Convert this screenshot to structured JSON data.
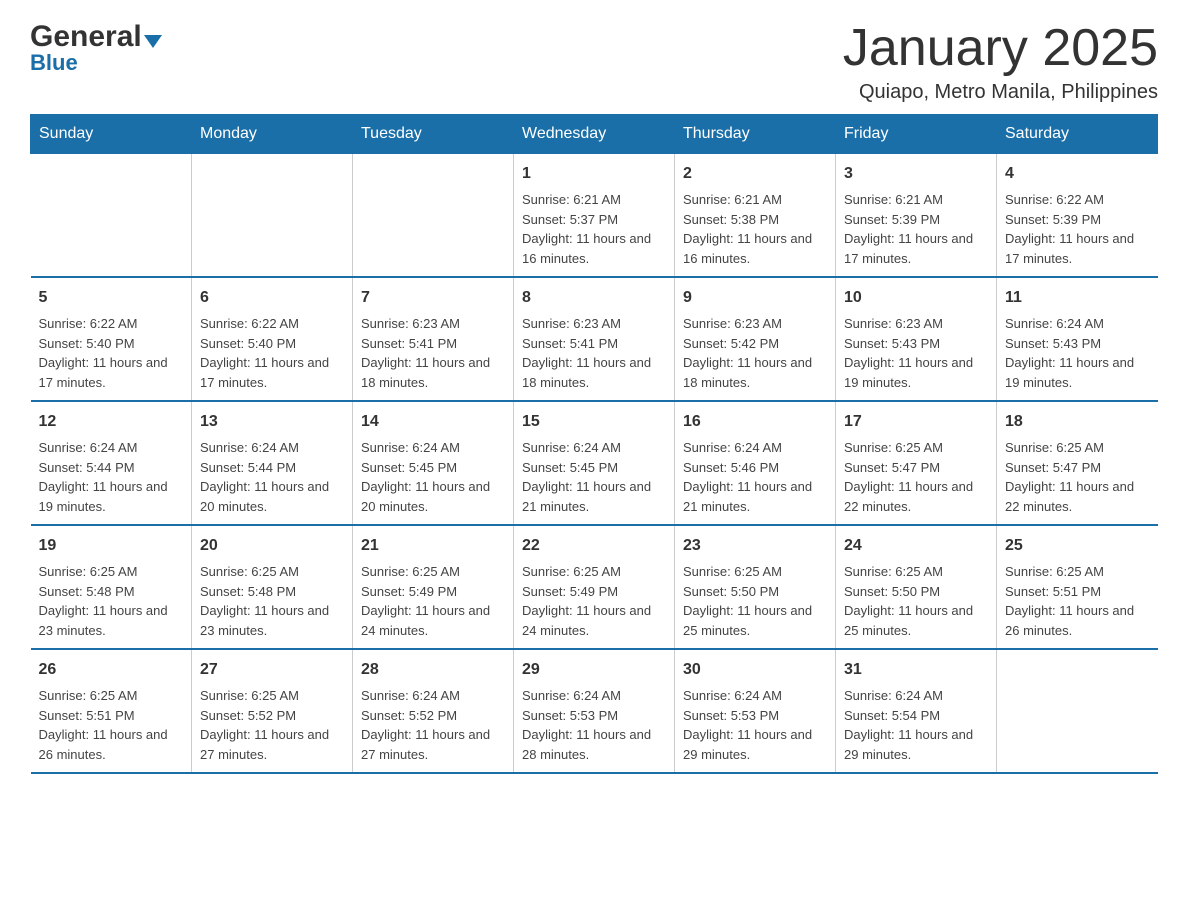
{
  "header": {
    "month_title": "January 2025",
    "location": "Quiapo, Metro Manila, Philippines"
  },
  "logo": {
    "line1_general": "General",
    "line2_blue": "Blue"
  },
  "days_of_week": [
    "Sunday",
    "Monday",
    "Tuesday",
    "Wednesday",
    "Thursday",
    "Friday",
    "Saturday"
  ],
  "weeks": [
    [
      {
        "day": "",
        "sunrise": "",
        "sunset": "",
        "daylight": ""
      },
      {
        "day": "",
        "sunrise": "",
        "sunset": "",
        "daylight": ""
      },
      {
        "day": "",
        "sunrise": "",
        "sunset": "",
        "daylight": ""
      },
      {
        "day": "1",
        "sunrise": "Sunrise: 6:21 AM",
        "sunset": "Sunset: 5:37 PM",
        "daylight": "Daylight: 11 hours and 16 minutes."
      },
      {
        "day": "2",
        "sunrise": "Sunrise: 6:21 AM",
        "sunset": "Sunset: 5:38 PM",
        "daylight": "Daylight: 11 hours and 16 minutes."
      },
      {
        "day": "3",
        "sunrise": "Sunrise: 6:21 AM",
        "sunset": "Sunset: 5:39 PM",
        "daylight": "Daylight: 11 hours and 17 minutes."
      },
      {
        "day": "4",
        "sunrise": "Sunrise: 6:22 AM",
        "sunset": "Sunset: 5:39 PM",
        "daylight": "Daylight: 11 hours and 17 minutes."
      }
    ],
    [
      {
        "day": "5",
        "sunrise": "Sunrise: 6:22 AM",
        "sunset": "Sunset: 5:40 PM",
        "daylight": "Daylight: 11 hours and 17 minutes."
      },
      {
        "day": "6",
        "sunrise": "Sunrise: 6:22 AM",
        "sunset": "Sunset: 5:40 PM",
        "daylight": "Daylight: 11 hours and 17 minutes."
      },
      {
        "day": "7",
        "sunrise": "Sunrise: 6:23 AM",
        "sunset": "Sunset: 5:41 PM",
        "daylight": "Daylight: 11 hours and 18 minutes."
      },
      {
        "day": "8",
        "sunrise": "Sunrise: 6:23 AM",
        "sunset": "Sunset: 5:41 PM",
        "daylight": "Daylight: 11 hours and 18 minutes."
      },
      {
        "day": "9",
        "sunrise": "Sunrise: 6:23 AM",
        "sunset": "Sunset: 5:42 PM",
        "daylight": "Daylight: 11 hours and 18 minutes."
      },
      {
        "day": "10",
        "sunrise": "Sunrise: 6:23 AM",
        "sunset": "Sunset: 5:43 PM",
        "daylight": "Daylight: 11 hours and 19 minutes."
      },
      {
        "day": "11",
        "sunrise": "Sunrise: 6:24 AM",
        "sunset": "Sunset: 5:43 PM",
        "daylight": "Daylight: 11 hours and 19 minutes."
      }
    ],
    [
      {
        "day": "12",
        "sunrise": "Sunrise: 6:24 AM",
        "sunset": "Sunset: 5:44 PM",
        "daylight": "Daylight: 11 hours and 19 minutes."
      },
      {
        "day": "13",
        "sunrise": "Sunrise: 6:24 AM",
        "sunset": "Sunset: 5:44 PM",
        "daylight": "Daylight: 11 hours and 20 minutes."
      },
      {
        "day": "14",
        "sunrise": "Sunrise: 6:24 AM",
        "sunset": "Sunset: 5:45 PM",
        "daylight": "Daylight: 11 hours and 20 minutes."
      },
      {
        "day": "15",
        "sunrise": "Sunrise: 6:24 AM",
        "sunset": "Sunset: 5:45 PM",
        "daylight": "Daylight: 11 hours and 21 minutes."
      },
      {
        "day": "16",
        "sunrise": "Sunrise: 6:24 AM",
        "sunset": "Sunset: 5:46 PM",
        "daylight": "Daylight: 11 hours and 21 minutes."
      },
      {
        "day": "17",
        "sunrise": "Sunrise: 6:25 AM",
        "sunset": "Sunset: 5:47 PM",
        "daylight": "Daylight: 11 hours and 22 minutes."
      },
      {
        "day": "18",
        "sunrise": "Sunrise: 6:25 AM",
        "sunset": "Sunset: 5:47 PM",
        "daylight": "Daylight: 11 hours and 22 minutes."
      }
    ],
    [
      {
        "day": "19",
        "sunrise": "Sunrise: 6:25 AM",
        "sunset": "Sunset: 5:48 PM",
        "daylight": "Daylight: 11 hours and 23 minutes."
      },
      {
        "day": "20",
        "sunrise": "Sunrise: 6:25 AM",
        "sunset": "Sunset: 5:48 PM",
        "daylight": "Daylight: 11 hours and 23 minutes."
      },
      {
        "day": "21",
        "sunrise": "Sunrise: 6:25 AM",
        "sunset": "Sunset: 5:49 PM",
        "daylight": "Daylight: 11 hours and 24 minutes."
      },
      {
        "day": "22",
        "sunrise": "Sunrise: 6:25 AM",
        "sunset": "Sunset: 5:49 PM",
        "daylight": "Daylight: 11 hours and 24 minutes."
      },
      {
        "day": "23",
        "sunrise": "Sunrise: 6:25 AM",
        "sunset": "Sunset: 5:50 PM",
        "daylight": "Daylight: 11 hours and 25 minutes."
      },
      {
        "day": "24",
        "sunrise": "Sunrise: 6:25 AM",
        "sunset": "Sunset: 5:50 PM",
        "daylight": "Daylight: 11 hours and 25 minutes."
      },
      {
        "day": "25",
        "sunrise": "Sunrise: 6:25 AM",
        "sunset": "Sunset: 5:51 PM",
        "daylight": "Daylight: 11 hours and 26 minutes."
      }
    ],
    [
      {
        "day": "26",
        "sunrise": "Sunrise: 6:25 AM",
        "sunset": "Sunset: 5:51 PM",
        "daylight": "Daylight: 11 hours and 26 minutes."
      },
      {
        "day": "27",
        "sunrise": "Sunrise: 6:25 AM",
        "sunset": "Sunset: 5:52 PM",
        "daylight": "Daylight: 11 hours and 27 minutes."
      },
      {
        "day": "28",
        "sunrise": "Sunrise: 6:24 AM",
        "sunset": "Sunset: 5:52 PM",
        "daylight": "Daylight: 11 hours and 27 minutes."
      },
      {
        "day": "29",
        "sunrise": "Sunrise: 6:24 AM",
        "sunset": "Sunset: 5:53 PM",
        "daylight": "Daylight: 11 hours and 28 minutes."
      },
      {
        "day": "30",
        "sunrise": "Sunrise: 6:24 AM",
        "sunset": "Sunset: 5:53 PM",
        "daylight": "Daylight: 11 hours and 29 minutes."
      },
      {
        "day": "31",
        "sunrise": "Sunrise: 6:24 AM",
        "sunset": "Sunset: 5:54 PM",
        "daylight": "Daylight: 11 hours and 29 minutes."
      },
      {
        "day": "",
        "sunrise": "",
        "sunset": "",
        "daylight": ""
      }
    ]
  ]
}
